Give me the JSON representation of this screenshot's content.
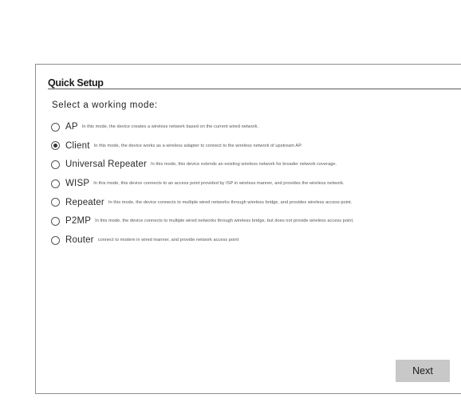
{
  "header": {
    "title": "Quick Setup"
  },
  "prompt": "Select a working mode:",
  "modes": [
    {
      "name": "AP",
      "description": "In this mode, the device creates a wireless network based on the current wired network.",
      "selected": false
    },
    {
      "name": "Client",
      "description": "In this mode, the device works as a wireless adapter to connect to the wireless network of upstream AP.",
      "selected": true
    },
    {
      "name": "Universal Repeater",
      "description": "In this mode, this device extends an existing wireless network for broader network coverage.",
      "selected": false
    },
    {
      "name": "WISP",
      "description": "In this mode, this device connects to an access point provided by ISP in wireless manner, and provides the wireless network.",
      "selected": false
    },
    {
      "name": "Repeater",
      "description": "In this mode, the device connects to multiple wired networks through wireless bridge, and provides wireless access point.",
      "selected": false
    },
    {
      "name": "P2MP",
      "description": "In this mode, the device connects to multiple wired networks through wireless bridge, but does not provide wireless access point.",
      "selected": false
    },
    {
      "name": "Router",
      "description": "connect to modem in wired manner, and provide network access point",
      "selected": false
    }
  ],
  "footer": {
    "next_label": "Next"
  },
  "colors": {
    "button_bg": "#c8c8c8",
    "panel_border": "#8d8d8d",
    "text": "#333333"
  }
}
